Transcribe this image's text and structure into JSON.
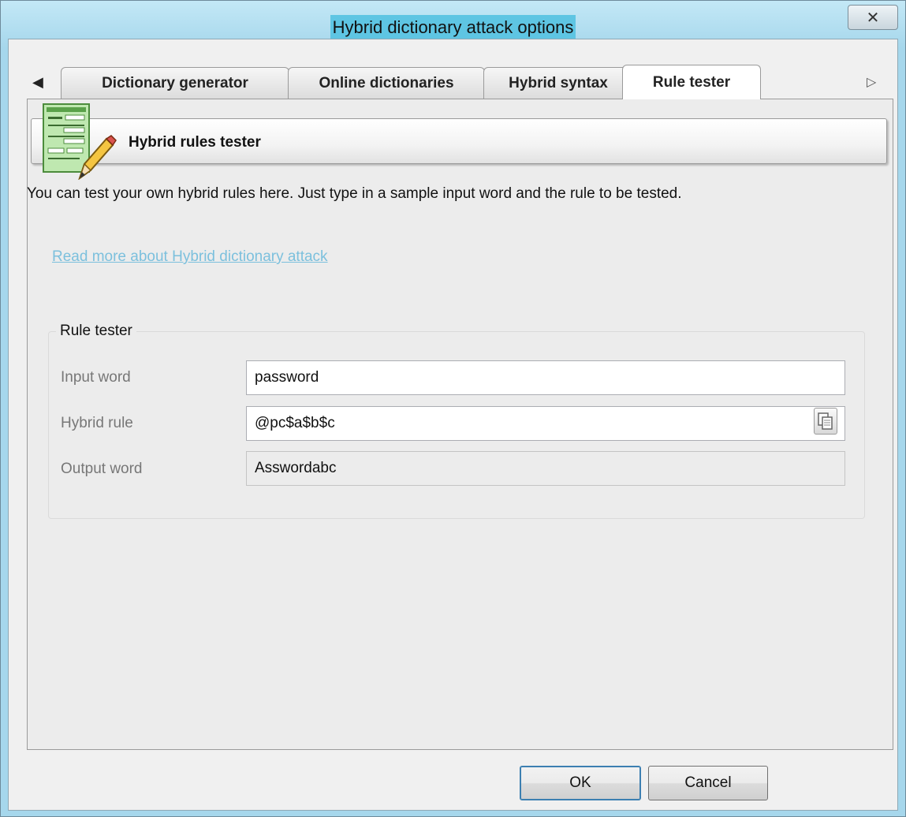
{
  "window": {
    "title": "Hybrid dictionary attack options",
    "close_glyph": "✕"
  },
  "tabs": {
    "scroll_left_glyph": "◀",
    "scroll_right_glyph": "▷",
    "items": [
      {
        "label": "Dictionary generator"
      },
      {
        "label": "Online dictionaries"
      },
      {
        "label": "Hybrid syntax"
      },
      {
        "label": "Rule tester",
        "active": true
      }
    ]
  },
  "header": {
    "title": "Hybrid rules tester",
    "icon": "form-pencil-icon"
  },
  "description": "You can test your own hybrid rules here. Just type in a sample input word and the rule to be tested.",
  "link": "Read more about Hybrid dictionary attack",
  "rule_tester": {
    "group_label": "Rule tester",
    "input_word_label": "Input word",
    "input_word_value": "password",
    "hybrid_rule_label": "Hybrid rule",
    "hybrid_rule_value": "@pc$a$b$c",
    "output_word_label": "Output word",
    "output_word_value": "Asswordabc",
    "copy_icon": "copy-icon"
  },
  "buttons": {
    "ok": "OK",
    "cancel": "Cancel"
  },
  "colors": {
    "title_highlight": "#5ec5e3",
    "link": "#7cc0dd",
    "frame": "#a6d7ec"
  }
}
